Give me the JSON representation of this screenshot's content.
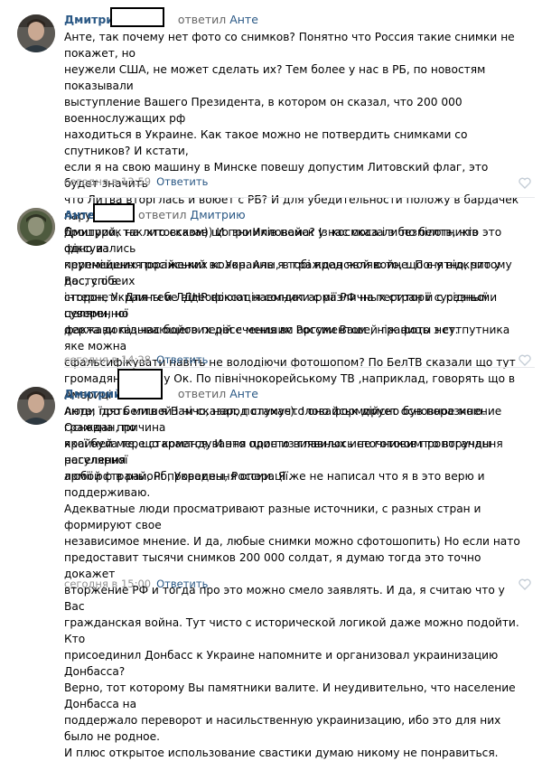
{
  "comments": [
    {
      "author": "Дмитрий",
      "reply_word": "ответил",
      "reply_to": "Анте",
      "text": "Анте, так почему нет фото со снимков? Понятно что Россия такие снимки не покажет, но\nнеужели США, не может сделать их? Тем более у нас в РБ, по новостям показывали\nвыступление Вашего Президента, в котором он сказал, что 200 000 военнослужащих рф\nнаходиться в Украине. Как такое можно не потвердить снимками со спутников? И кстати,\nесли я на свою машину в Минске повешу допустим Литовский флаг, это будет значить\nчто Литва вторглась и воюет с РБ? И для убедительности положу в бардачек пару\nброшурок на литовском)) И про Илловайск у нас сказали по белтв, что это одно из\nкрупнейших поражений вс Украины, в гражданской войне. Понятно, что у Вас, с обеих\nсторон, Украины и ЛДНР воюют наемники с различных стран и с разными целями, но\nфакта доказывающего пересечения вс России Вашей границы нет.",
      "time": "сегодня в 13:59",
      "reply_label": "Ответить"
    },
    {
      "author": "Анте",
      "reply_word": "ответил",
      "reply_to": "Дмитрию",
      "text": "Дмитрий, так хто сказав що знимків нема? Із космоса і з безпілотників фіксувались\nпереміщення російських колон. Але я тобі пред являю то, що є у відкритому доступі в\nінтернеті. Для тебе відеофіксація солдат армії РФ на території сусідньої суверенної\nдержави під час бойових дій є меншим аргументом , ніж фото з сутпутника яке можна\nсфальсифікувати навіть не володіючи фотошопом? По БелТВ сказали що тут\nгромадянська? Ну Ок. По північнокорейському ТВ ,наприклад, говорять що в Америці\nлюди їдять мишей і нічо, народ слухає). Іловайськ дійсно був поразкою. Основна причина\nякої була те, що командування просто виявилось не готовим то втручання регулярної\nармії рф в районі проведення операції.",
      "time": "сегодня в 14:28",
      "reply_label": "Ответить"
    },
    {
      "author": "Дмитрий",
      "reply_word": "ответил",
      "reply_to": "Анте",
      "text": "Анте, про белтв я Вам сказал, потамучто оно формирует основное мнение граждан, по\nкрайней мере старается. И это один из главных источников пропоганды населения\nлюбой страны, Рб, Украины, России. Я же не написал что я в это верю и поддерживаю.\nАдекватные люди просматривают разные источники, с разных стран и формируют свое\nнезависимое мнение. И да, любые снимки можно сфотошопить) Но если нато\nпредоставит тысячи снимков 200 000 солдат, я думаю тогда это точно докажет\nвторжение РФ и тогда про это можно смело заявлять. И да, я считаю что у Вас\nгражданская война. Тут чисто с исторической логикой даже можно подойти. Кто\nприсоединил Донбасс к Украине напомните и организовал украинизацию Донбасса?\nВерно, тот которому Вы памятники валите. И неудивительно, что население Донбасса на\nподдержало переворот и насильственную украинизацию, ибо это для них было не родное.\nИ плюс открытое использование свастики думаю никому не понравиться.",
      "time": "сегодня в 15:00",
      "reply_label": "Ответить"
    }
  ],
  "colors": {
    "link": "#2a5885",
    "meta": "#939393",
    "divider": "#e7e8ec"
  },
  "icons": {
    "like": "heart-outline-icon"
  }
}
